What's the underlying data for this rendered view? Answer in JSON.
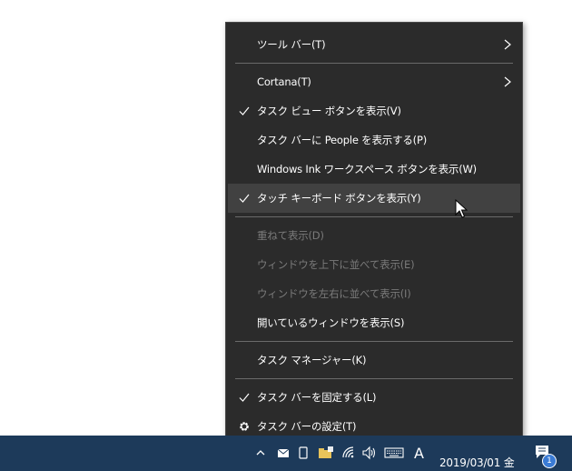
{
  "menu": {
    "items": [
      {
        "label": "ツール バー(T)",
        "checked": false,
        "disabled": false,
        "submenu": true
      },
      {
        "label": "Cortana(T)",
        "checked": false,
        "disabled": false,
        "submenu": true
      },
      {
        "label": "タスク ビュー ボタンを表示(V)",
        "checked": true,
        "disabled": false,
        "submenu": false
      },
      {
        "label": "タスク バーに People を表示する(P)",
        "checked": false,
        "disabled": false,
        "submenu": false
      },
      {
        "label": "Windows Ink ワークスペース ボタンを表示(W)",
        "checked": false,
        "disabled": false,
        "submenu": false
      },
      {
        "label": "タッチ キーボード ボタンを表示(Y)",
        "checked": true,
        "disabled": false,
        "submenu": false,
        "hovered": true
      },
      {
        "label": "重ねて表示(D)",
        "checked": false,
        "disabled": true,
        "submenu": false
      },
      {
        "label": "ウィンドウを上下に並べて表示(E)",
        "checked": false,
        "disabled": true,
        "submenu": false
      },
      {
        "label": "ウィンドウを左右に並べて表示(I)",
        "checked": false,
        "disabled": true,
        "submenu": false
      },
      {
        "label": "開いているウィンドウを表示(S)",
        "checked": false,
        "disabled": false,
        "submenu": false
      },
      {
        "label": "タスク マネージャー(K)",
        "checked": false,
        "disabled": false,
        "submenu": false
      },
      {
        "label": "タスク バーを固定する(L)",
        "checked": true,
        "disabled": false,
        "submenu": false
      },
      {
        "label": "タスク バーの設定(T)",
        "checked": false,
        "disabled": false,
        "submenu": false,
        "icon": "gear-icon"
      }
    ]
  },
  "taskbar": {
    "ime_indicator": "A",
    "clock_date": "2019/03/01 金",
    "notification_count": "1",
    "tray_icons": [
      "chevron-up-icon",
      "mail-icon",
      "phone-icon",
      "folder-icon",
      "wifi-icon",
      "volume-icon",
      "keyboard-icon"
    ]
  },
  "colors": {
    "menu_bg": "#2b2b2b",
    "menu_hover": "#414141",
    "menu_disabled_text": "#7a7a7a",
    "taskbar_bg": "#1d3a5a",
    "badge_bg": "#3a7bd5"
  }
}
